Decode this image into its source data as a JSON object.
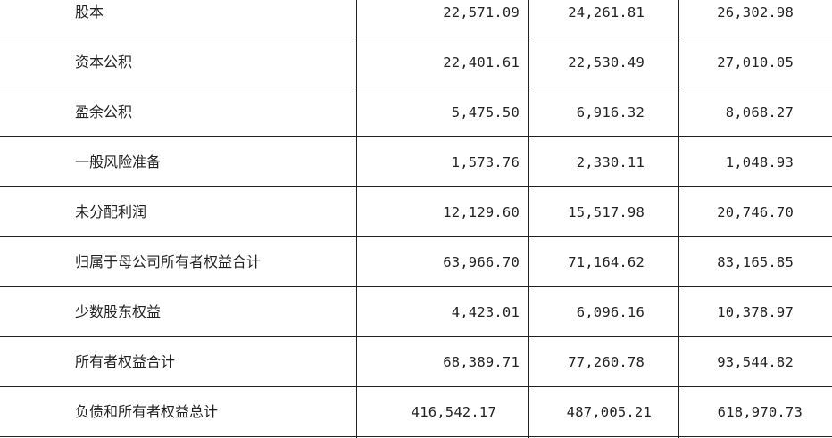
{
  "rows": [
    {
      "label": "股本",
      "v1": "22,571.09",
      "v2": "24,261.81",
      "v3": "26,302.98"
    },
    {
      "label": "资本公积",
      "v1": "22,401.61",
      "v2": "22,530.49",
      "v3": "27,010.05"
    },
    {
      "label": "盈余公积",
      "v1": "5,475.50",
      "v2": "6,916.32",
      "v3": "8,068.27"
    },
    {
      "label": "一般风险准备",
      "v1": "1,573.76",
      "v2": "2,330.11",
      "v3": "1,048.93"
    },
    {
      "label": "未分配利润",
      "v1": "12,129.60",
      "v2": "15,517.98",
      "v3": "20,746.70"
    },
    {
      "label": "归属于母公司所有者权益合计",
      "v1": "63,966.70",
      "v2": "71,164.62",
      "v3": "83,165.85"
    },
    {
      "label": "少数股东权益",
      "v1": "4,423.01",
      "v2": "6,096.16",
      "v3": "10,378.97"
    },
    {
      "label": "所有者权益合计",
      "v1": "68,389.71",
      "v2": "77,260.78",
      "v3": "93,544.82"
    },
    {
      "label": "负债和所有者权益总计",
      "v1": "416,542.17",
      "v2": "487,005.21",
      "v3": "618,970.73"
    }
  ]
}
